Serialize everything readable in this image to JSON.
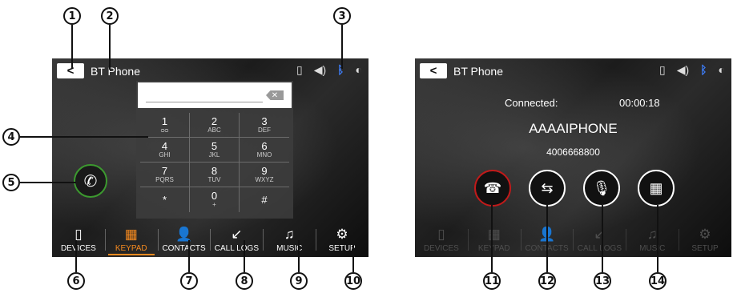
{
  "callouts": [
    "1",
    "2",
    "3",
    "4",
    "5",
    "6",
    "7",
    "8",
    "9",
    "10",
    "11",
    "12",
    "13",
    "14"
  ],
  "screen1": {
    "title": "BT Phone",
    "back_glyph": "<",
    "status_icons": [
      "phone-sync-icon",
      "volume-icon",
      "bluetooth-icon",
      "brightness-icon"
    ],
    "keys": [
      {
        "digit": "1",
        "letters": "ᴑᴑ"
      },
      {
        "digit": "2",
        "letters": "ABC"
      },
      {
        "digit": "3",
        "letters": "DEF"
      },
      {
        "digit": "4",
        "letters": "GHI"
      },
      {
        "digit": "5",
        "letters": "JKL"
      },
      {
        "digit": "6",
        "letters": "MNO"
      },
      {
        "digit": "7",
        "letters": "PQRS"
      },
      {
        "digit": "8",
        "letters": "TUV"
      },
      {
        "digit": "9",
        "letters": "WXYZ"
      },
      {
        "digit": "*",
        "letters": ""
      },
      {
        "digit": "0",
        "letters": "+"
      },
      {
        "digit": "#",
        "letters": ""
      }
    ],
    "nav": [
      {
        "label": "DEVICES",
        "icon": "phone-icon"
      },
      {
        "label": "KEYPAD",
        "icon": "keypad-icon",
        "active": true
      },
      {
        "label": "CONTACTS",
        "icon": "person-icon"
      },
      {
        "label": "CALL LOGS",
        "icon": "arrow-icon"
      },
      {
        "label": "MUSIC",
        "icon": "music-note-icon"
      },
      {
        "label": "SETUP",
        "icon": "gear-icon"
      }
    ]
  },
  "screen2": {
    "title": "BT Phone",
    "back_glyph": "<",
    "connected_label": "Connected:",
    "call_time": "00:00:18",
    "device_name": "AAAAIPHONE",
    "phone_number": "4006668800",
    "nav": [
      {
        "label": "DEVICES"
      },
      {
        "label": "KEYPAD"
      },
      {
        "label": "CONTACTS"
      },
      {
        "label": "CALL LOGS"
      },
      {
        "label": "MUSIC"
      },
      {
        "label": "SETUP"
      }
    ]
  },
  "colors": {
    "accent": "#f58a1f",
    "call_green": "#3c9a2f",
    "end_red": "#c11a1a",
    "bluetooth": "#3d7cf5"
  }
}
